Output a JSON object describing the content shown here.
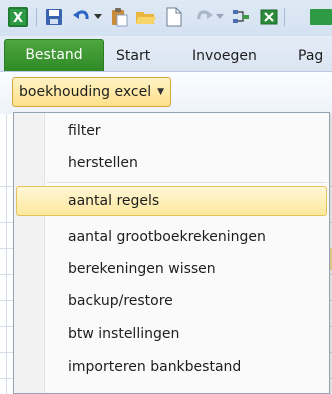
{
  "ribbon": {
    "tabs": [
      {
        "label": "Bestand"
      },
      {
        "label": "Start"
      },
      {
        "label": "Invoegen"
      },
      {
        "label": "Pag"
      }
    ],
    "menu_button": {
      "label": "boekhouding excel"
    }
  },
  "menu": {
    "items": [
      {
        "label": "filter"
      },
      {
        "label": "herstellen"
      },
      {
        "label": "aantal regels"
      },
      {
        "label": "aantal grootboekrekeningen"
      },
      {
        "label": "berekeningen wissen"
      },
      {
        "label": "backup/restore"
      },
      {
        "label": "btw instellingen"
      },
      {
        "label": "importeren bankbestand"
      }
    ]
  },
  "colors": {
    "file_tab": "#3a9a30",
    "menu_highlight": "#fde99e",
    "ribbon_bg": "#dbe5f2"
  },
  "icons": [
    "excel-icon",
    "save-icon",
    "undo-icon",
    "paste-icon",
    "open-folder-icon",
    "new-document-icon",
    "redo-icon",
    "format-icon",
    "excel-small-icon"
  ]
}
